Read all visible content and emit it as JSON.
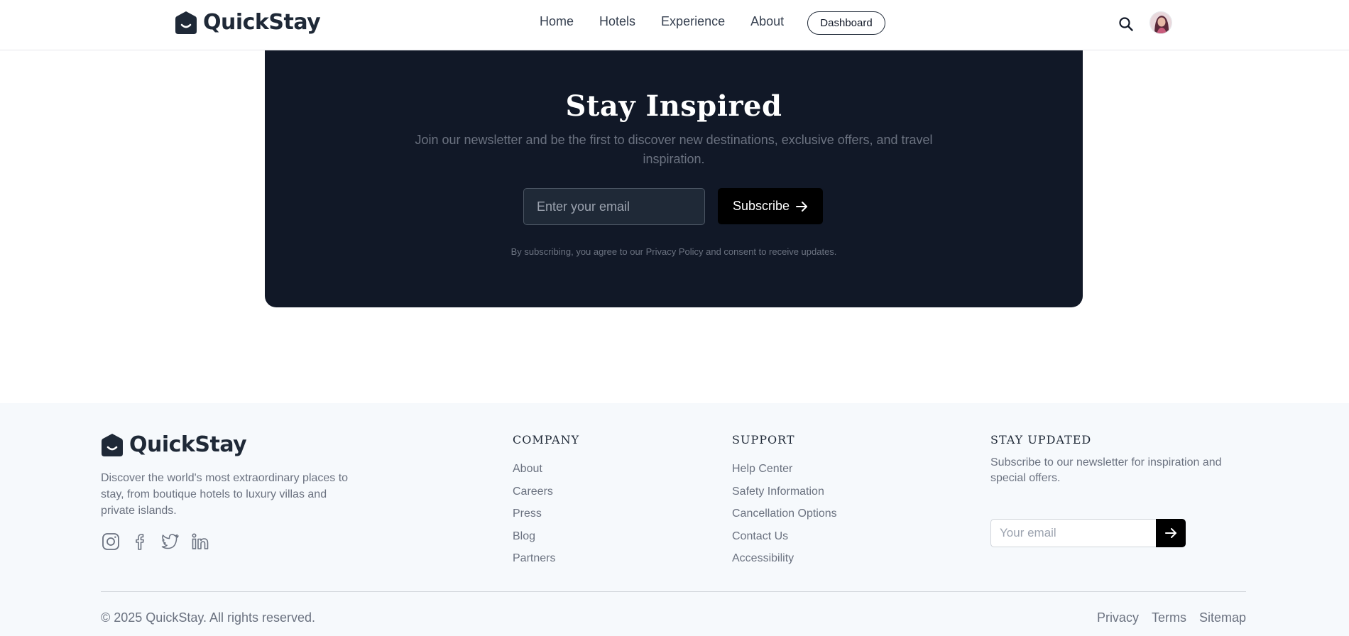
{
  "nav": {
    "brand": "QuickStay",
    "links": [
      "Home",
      "Hotels",
      "Experience",
      "About"
    ],
    "dashboard_label": "Dashboard",
    "search_icon": "search-icon",
    "avatar": "user-avatar"
  },
  "newsletter": {
    "title": "Stay Inspired",
    "subtitle": "Join our newsletter and be the first to discover new destinations, exclusive offers, and travel inspiration.",
    "email_placeholder": "Enter your email",
    "subscribe_label": "Subscribe",
    "legal": "By subscribing, you agree to our Privacy Policy and consent to receive updates."
  },
  "footer": {
    "brand": "QuickStay",
    "description": "Discover the world's most extraordinary places to stay, from boutique hotels to luxury villas and private islands.",
    "social": [
      "instagram-icon",
      "facebook-icon",
      "twitter-icon",
      "linkedin-icon"
    ],
    "company": {
      "heading": "COMPANY",
      "links": [
        "About",
        "Careers",
        "Press",
        "Blog",
        "Partners"
      ]
    },
    "support": {
      "heading": "SUPPORT",
      "links": [
        "Help Center",
        "Safety Information",
        "Cancellation Options",
        "Contact Us",
        "Accessibility"
      ]
    },
    "stay_updated": {
      "heading": "STAY UPDATED",
      "text": "Subscribe to our newsletter for inspiration and special offers.",
      "email_placeholder": "Your email"
    },
    "copyright": "© 2025 QuickStay. All rights reserved.",
    "bottom_links": [
      "Privacy",
      "Terms",
      "Sitemap"
    ]
  },
  "colors": {
    "newsletter_bg": "#111827",
    "footer_bg": "#f6f9fc",
    "button_bg": "#000000"
  }
}
